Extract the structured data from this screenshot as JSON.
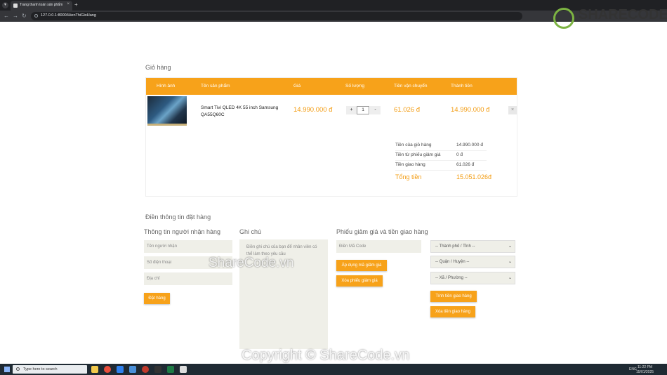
{
  "browser": {
    "tab_title": "Trang thanh toán sản phẩm",
    "tab_close": "×",
    "new_tab": "+",
    "menu": "▾",
    "back": "←",
    "forward": "→",
    "reload": "↻",
    "home": "⌂",
    "url": "127.0.0.1:8000/HienThiGioHang"
  },
  "cart": {
    "title": "Giỏ hàng",
    "columns": [
      "Hình ảnh",
      "Tên sản phẩm",
      "Giá",
      "Số lượng",
      "Tiền vận chuyển",
      "Thành tiền"
    ],
    "item": {
      "image_icon": "tv-image",
      "name": "Smart Tivi QLED 4K 55 inch Samsung QA55Q60C",
      "price": "14.990.000 đ",
      "qty_minus": "+",
      "qty": "1",
      "qty_plus": "-",
      "shipping": "61.026 đ",
      "subtotal": "14.990.000 đ",
      "remove": "×"
    },
    "summary": [
      {
        "label": "Tiền của giỏ hàng",
        "value": "14.990.000 đ"
      },
      {
        "label": "Tiền từ phiếu giảm giá",
        "value": "0 đ"
      },
      {
        "label": "Tiền giao hàng",
        "value": "61.026 đ"
      }
    ],
    "total_label": "Tổng tiền",
    "total_value": "15.051.026đ"
  },
  "order": {
    "title": "Điền thông tin đặt hàng",
    "recipient": {
      "heading": "Thông tin người nhận hàng",
      "name_placeholder": "Tên người nhận",
      "phone_placeholder": "Số điện thoại",
      "address_placeholder": "Địa chỉ",
      "submit": "Đặt hàng"
    },
    "note": {
      "heading": "Ghi chú",
      "placeholder": "Điền ghi chú của bạn để nhân viên có thể làm theo yêu cầu"
    },
    "voucher": {
      "heading": "Phiếu giảm giá và tiền giao hàng",
      "code_placeholder": "Điền Mã Code",
      "apply": "Áp dụng mã giảm giá",
      "remove": "Xóa phiếu giảm giá",
      "city": "-- Thành phố / Tỉnh --",
      "district": "-- Quận / Huyện --",
      "ward": "-- Xã / Phường --",
      "calc_shipping": "Tính tiền giao hàng",
      "remove_shipping": "Xóa tiền giao hàng"
    }
  },
  "taskbar": {
    "search": "Type here to search",
    "time": "11:22 PM",
    "date": "15/01/2025",
    "lang": "ENG"
  },
  "watermark": {
    "logo": "SHARECODE.vn",
    "mid": "ShareCode.vn",
    "bottom": "Copyright © ShareCode.vn"
  },
  "colors": {
    "accent": "#f7a21a",
    "price": "#f39c12",
    "field_bg": "#efefe8"
  }
}
